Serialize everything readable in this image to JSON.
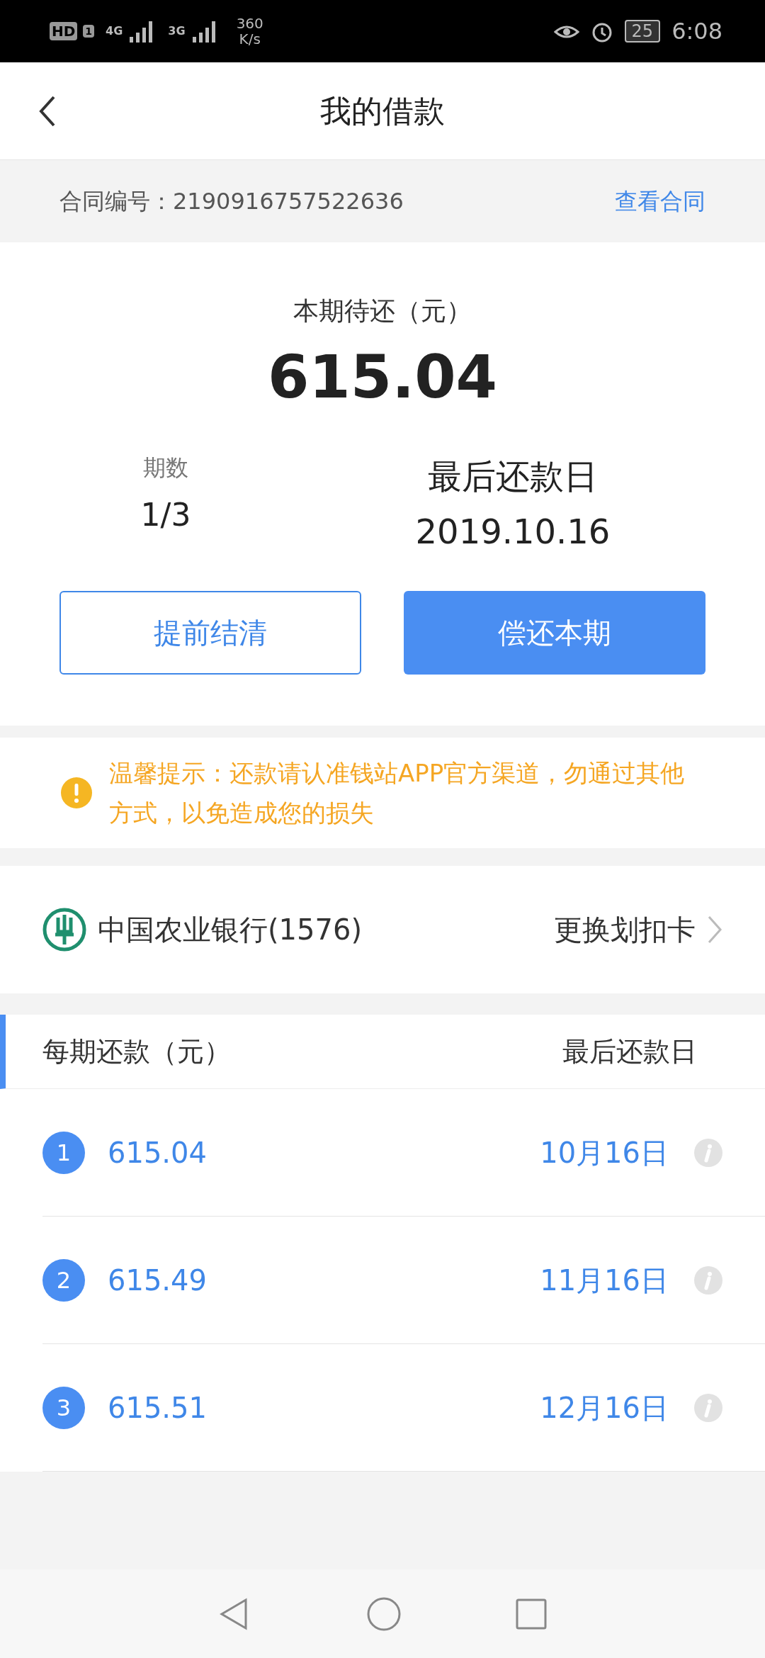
{
  "status_bar": {
    "hd": "HD",
    "sim": "1",
    "net_1": "4G",
    "net_2": "3G",
    "speed": "360",
    "speed_unit": "K/s",
    "battery": "25",
    "time": "6:08"
  },
  "header": {
    "title": "我的借款"
  },
  "contract": {
    "label": "合同编号：2190916757522636",
    "link": "查看合同"
  },
  "summary": {
    "label": "本期待还（元）",
    "amount": "615.04",
    "period_label": "期数",
    "period_value": "1/3",
    "due_label": "最后还款日",
    "due_value": "2019.10.16"
  },
  "buttons": [
    {
      "label": "提前结清",
      "kind": "outline"
    },
    {
      "label": "偿还本期",
      "kind": "primary"
    }
  ],
  "notice": {
    "text": "温馨提示：还款请认准钱站APP官方渠道，勿通过其他方式，以免造成您的损失"
  },
  "bank": {
    "name": "中国农业银行(1576)",
    "action": "更换划扣卡"
  },
  "schedule": {
    "columns": [
      "每期还款（元）",
      "最后还款日"
    ],
    "rows": [
      {
        "index": "1",
        "amount": "615.04",
        "date": "10月16日"
      },
      {
        "index": "2",
        "amount": "615.49",
        "date": "11月16日"
      },
      {
        "index": "3",
        "amount": "615.51",
        "date": "12月16日"
      }
    ]
  }
}
